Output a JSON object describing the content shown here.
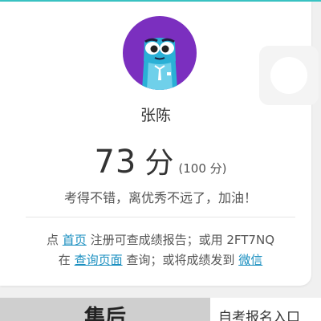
{
  "user": {
    "name": "张陈"
  },
  "score": {
    "value": "73",
    "unit": "分",
    "total": "(100 分)"
  },
  "comment": "考得不错，离优秀不远了，加油！",
  "info": {
    "line1_prefix": "点",
    "home_link": "首页",
    "line1_middle": "注册可查成绩报告；或用",
    "code": "2FT7NQ",
    "line2_prefix": "在",
    "query_link": "查询页面",
    "line2_middle": "查询；或将成绩发到",
    "wechat_link": "微信"
  },
  "bottom": {
    "left_label": "集后",
    "right_label": "自考报名入口"
  },
  "colors": {
    "avatar_bg": "#7b2fbf",
    "link": "#1a8fc0",
    "accent_bar": "#38c3c3"
  }
}
